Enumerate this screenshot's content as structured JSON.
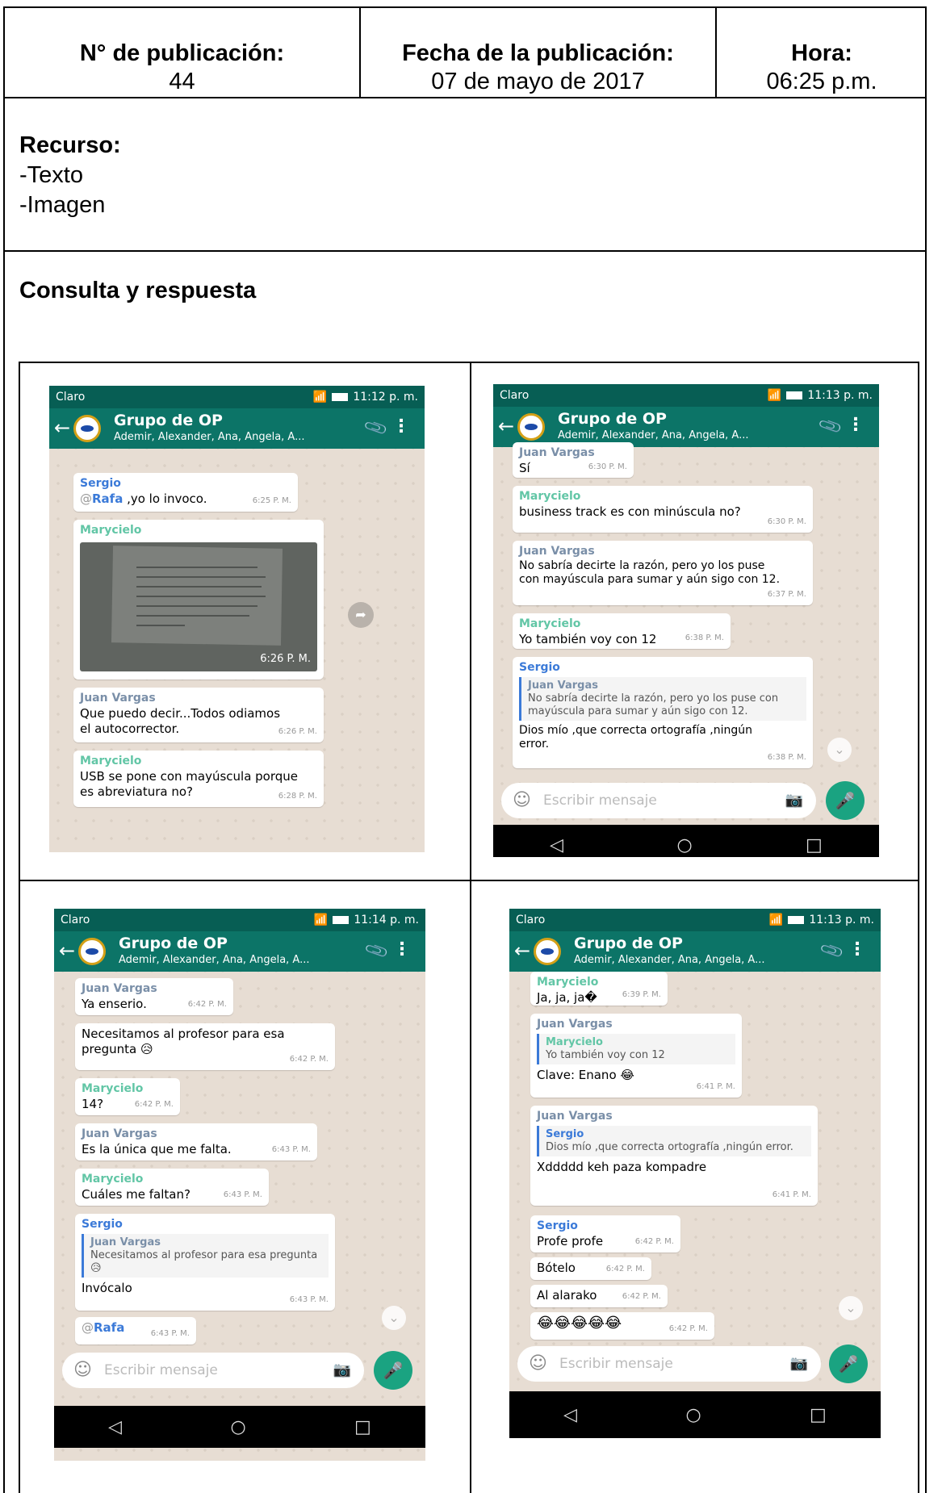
{
  "header": {
    "pub_label": "N°  de publicación:",
    "pub_value": "44",
    "date_label": "Fecha de la publicación:",
    "date_value": "07 de mayo de 2017",
    "time_label": "Hora:",
    "time_value": "06:25 p.m."
  },
  "recurso": {
    "title": "Recurso:",
    "items": [
      "-Texto",
      "-Imagen"
    ]
  },
  "consulta_title": "Consulta y respuesta",
  "chat": {
    "carrier": "Claro",
    "group_name": "Grupo de OP",
    "members": "Ademir, Alexander, Ana, Angela, A...",
    "input_placeholder": "Escribir mensaje"
  },
  "screens": [
    {
      "clock": "11:12 p. m.",
      "messages": [
        {
          "sender": "Sergio",
          "mention": "@",
          "mention_name": "Rafa",
          "text": " ,yo lo invoco.",
          "time": "6:25 P. M."
        },
        {
          "sender": "Marycielo",
          "image_time": "6:26 P. M."
        },
        {
          "sender": "Juan Vargas",
          "text": "Que puedo decir...Todos odiamos el autocorrector.",
          "time": "6:26 P. M."
        },
        {
          "sender": "Marycielo",
          "text": "USB se pone con mayúscula porque es abreviatura no?",
          "time": "6:28 P. M."
        }
      ]
    },
    {
      "clock": "11:13 p. m.",
      "messages": [
        {
          "sender": "Juan Vargas",
          "text": "Sí",
          "time": "6:30 P. M."
        },
        {
          "sender": "Marycielo",
          "text": "business track es con minúscula no?",
          "time": "6:30 P. M."
        },
        {
          "sender": "Juan Vargas",
          "text": "No sabría decirte la razón, pero yo los puse con mayúscula para sumar y aún sigo con 12.",
          "time": "6:37 P. M."
        },
        {
          "sender": "Marycielo",
          "text": "Yo también voy con 12",
          "time": "6:38 P. M."
        },
        {
          "sender": "Sergio",
          "quote_sender": "Juan Vargas",
          "quote_text": "No sabría decirte la razón, pero yo los puse con mayúscula para sumar y aún sigo con 12.",
          "text": "Dios mío ,que correcta ortografía ,ningún error.",
          "time": "6:38 P. M."
        }
      ]
    },
    {
      "clock": "11:14 p. m.",
      "messages": [
        {
          "sender": "Juan Vargas",
          "text": "Ya enserio.",
          "time": "6:42 P. M."
        },
        {
          "text": "Necesitamos al profesor para esa pregunta 😥",
          "time": "6:42 P. M."
        },
        {
          "sender": "Marycielo",
          "text": "14?",
          "time": "6:42 P. M."
        },
        {
          "sender": "Juan Vargas",
          "text": "Es la única que me falta.",
          "time": "6:43 P. M."
        },
        {
          "sender": "Marycielo",
          "text": "Cuáles me faltan?",
          "time": "6:43 P. M."
        },
        {
          "sender": "Sergio",
          "quote_sender": "Juan Vargas",
          "quote_text": "Necesitamos al profesor para esa pregunta 😥",
          "text": "Invócalo",
          "time": "6:43 P. M."
        },
        {
          "mention": "@",
          "mention_name": "Rafa",
          "time": "6:43 P. M."
        }
      ]
    },
    {
      "clock": "11:13 p. m.",
      "messages": [
        {
          "sender": "Marycielo",
          "text": "Ja, ja, ja�",
          "time": "6:39 P. M."
        },
        {
          "sender": "Juan Vargas",
          "quote_sender": "Marycielo",
          "quote_text": "Yo también voy con 12",
          "text": "Clave: Enano 😂",
          "time": "6:41 P. M."
        },
        {
          "sender": "Juan Vargas",
          "quote_sender": "Sergio",
          "quote_text": "Dios mío ,que correcta ortografía ,ningún error.",
          "text": "Xddddd keh paza kompadre",
          "time": "6:41 P. M."
        },
        {
          "sender": "Sergio",
          "text": "Profe profe",
          "time": "6:42 P. M."
        },
        {
          "text": "Bótelo",
          "time": "6:42 P. M."
        },
        {
          "text": "Al alarako",
          "time": "6:42 P. M."
        },
        {
          "text": "😂😂😂😂😂",
          "time": "6:42 P. M."
        }
      ]
    }
  ]
}
